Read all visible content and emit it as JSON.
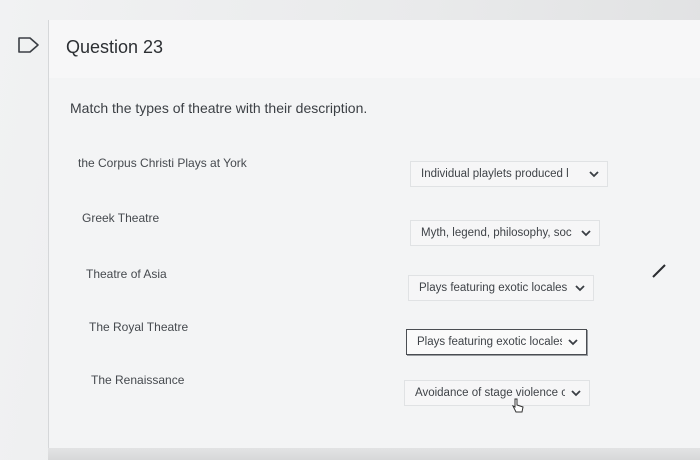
{
  "question": {
    "title": "Question 23",
    "prompt": "Match the types of theatre with their description."
  },
  "items": [
    {
      "term": "the Corpus Christi Plays at York",
      "selected": "Individual playlets produced l"
    },
    {
      "term": "Greek Theatre",
      "selected": "Myth, legend, philosophy, soc"
    },
    {
      "term": "Theatre of Asia",
      "selected": "Plays featuring exotic locales"
    },
    {
      "term": "The Royal Theatre",
      "selected": "Plays featuring exotic locales"
    },
    {
      "term": "The Renaissance",
      "selected": "Avoidance of stage violence c"
    }
  ],
  "icons": {
    "flag": "flag-icon",
    "dropdown": "chevron-down-icon",
    "cursor": "pointer-cursor-icon"
  },
  "colors": {
    "focus_border": "#4a4d52",
    "text": "#3b3f44"
  }
}
